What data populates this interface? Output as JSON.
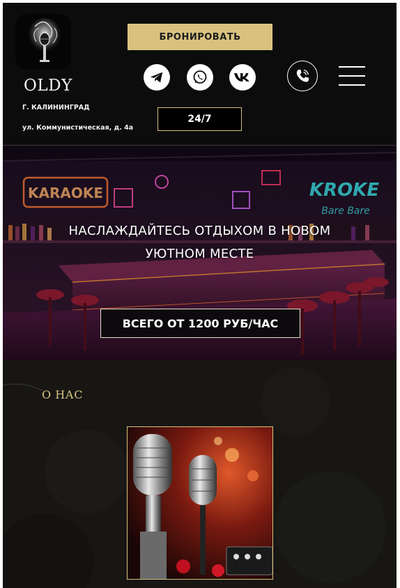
{
  "header": {
    "brand": "OLDY",
    "city": "Г. КАЛИНИНГРАД",
    "address": "ул. Коммунистическая, д. 4а",
    "book_label": "БРОНИРОВАТЬ",
    "hours": "24/7",
    "socials": [
      "telegram-icon",
      "whatsapp-icon",
      "vk-icon"
    ],
    "phone_icon": "phone-icon",
    "menu_icon": "hamburger-menu-icon"
  },
  "hero": {
    "title": "НАСЛАЖДАЙТЕСЬ ОТДЫХОМ В НОВОМ УЮТНОМ МЕСТЕ",
    "price_label": "ВСЕГО ОТ 1200 РУБ/ЧАС",
    "neon_karaoke": "KARAOKE",
    "neon_right": "KROKE",
    "neon_right_sub": "Bare Bare"
  },
  "about": {
    "title": "О НАС"
  },
  "colors": {
    "accent_gold": "#d8c27e",
    "header_bg": "#0c0c0c",
    "about_bg": "#171613"
  }
}
